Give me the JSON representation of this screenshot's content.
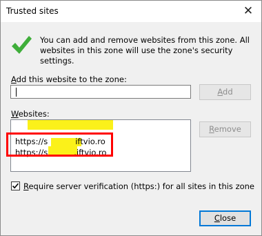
{
  "window": {
    "title": "Trusted sites",
    "close_glyph": "✕"
  },
  "info": {
    "icon": "green-checkmark-icon",
    "text": "You can add and remove websites from this zone. All websites in this zone will use the zone's security settings."
  },
  "add_section": {
    "label_accel": "A",
    "label_rest": "dd this website to the zone:",
    "input_value": "",
    "add_button_accel": "A",
    "add_button_rest": "dd"
  },
  "websites_section": {
    "label_accel": "W",
    "label_rest": "ebsites:",
    "items": [
      "https://s",
      "https://s"
    ],
    "item_suffixes": [
      "iftvio.ro",
      ".iftvio.ro"
    ],
    "remove_button_accel": "R",
    "remove_button_rest": "emove"
  },
  "verification": {
    "checked": true,
    "label_accel": "R",
    "label_rest": "equire server verification (https:) for all sites in this zone"
  },
  "close_button": {
    "accel": "C",
    "rest": "lose"
  },
  "colors": {
    "highlight": "#fbf11a",
    "annotation_box": "#ff0000",
    "check_green": "#3fae3a",
    "default_button_border": "#0078d7"
  }
}
